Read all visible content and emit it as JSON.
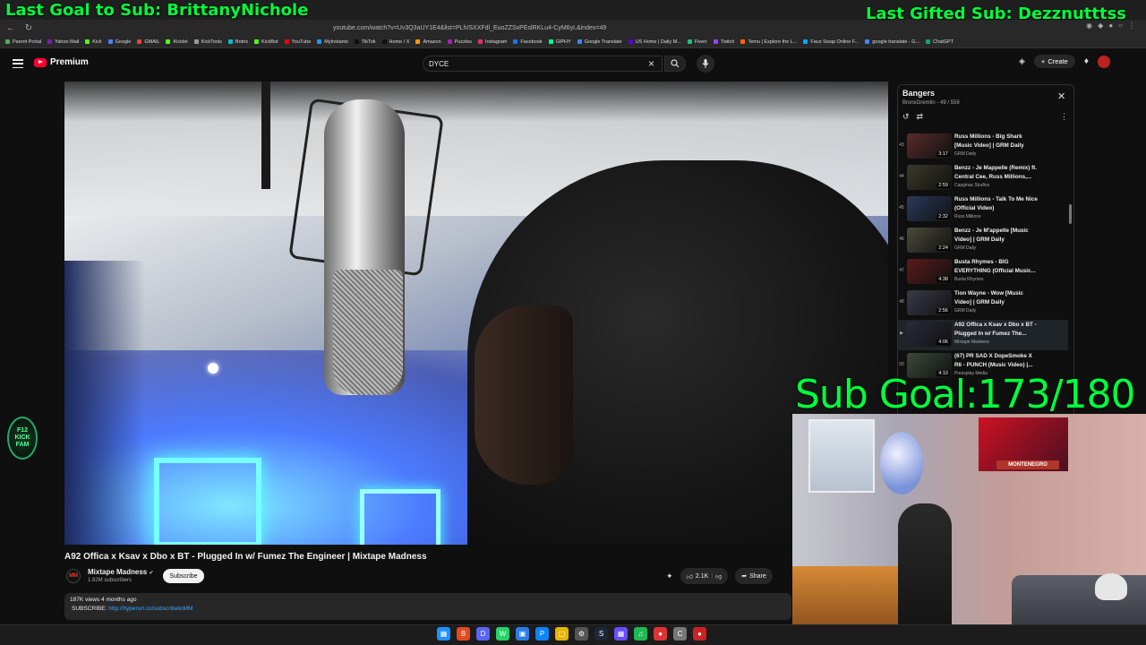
{
  "overlays": {
    "last_goal": "Last Goal to Sub: BrittanyNichole",
    "last_gifted": "Last Gifted Sub: Dezznutttss",
    "sub_goal": "Sub Goal:173/180"
  },
  "browser": {
    "url": "youtube.com/watch?v=Uv3Q3aUY1E4&list=PLhISXXFdl_EuoZZSxPEslRKLu4-CyM6yL&index=49",
    "bookmarks": [
      "Parent Portal",
      "Yahoo Mail",
      "Kick",
      "Google",
      "GMAIL",
      "Kicklet",
      "KickTools",
      "Botrix",
      "KickBot",
      "YouTube",
      "MyInstants",
      "TikTok",
      "Home / X",
      "Amazon",
      "Puzzles",
      "Instagram",
      "Facebook",
      "GIPHY",
      "Google Translate",
      "US Home | Daily M...",
      "Fiverr",
      "Twitch",
      "Temu | Explore the L...",
      "Face Swap Online F...",
      "google translate - G...",
      "ChatGPT"
    ]
  },
  "youtube": {
    "logo_text": "Premium",
    "search_value": "DYCE",
    "create_label": "Create"
  },
  "video": {
    "title": "A92 Offica x Ksav x Dbo x BT - Plugged In w/ Fumez The Engineer | Mixtape Madness",
    "channel": "Mixtape Madness",
    "subscribers": "1.82M subscribers",
    "subscribe_label": "Subscribe",
    "likes": "2.1K",
    "share_label": "Share",
    "meta": "187K views  4 months ago",
    "subscribe_prefix": "SUBSCRIBE:",
    "subscribe_link": "http://hyperurl.co/subscribetoMM"
  },
  "playlist": {
    "title": "Bangers",
    "subtitle": "BronxGremlin - 49 / 559",
    "items": [
      {
        "index": "43",
        "title": "Russ Millions - Big Shark [Music Video] | GRM Daily",
        "channel": "GRM Daily",
        "duration": "3:17"
      },
      {
        "index": "44",
        "title": "Benzz - Je Mappelle (Remix) ft. Central Cee, Russ Millions,...",
        "channel": "Capginac Studios",
        "duration": "2:59"
      },
      {
        "index": "45",
        "title": "Russ Millions - Talk To Me Nice (Official Video)",
        "channel": "Russ Millions",
        "duration": "2:32"
      },
      {
        "index": "46",
        "title": "Benzz - Je M'appelle [Music Video] | GRM Daily",
        "channel": "GRM Daily",
        "duration": "2:24"
      },
      {
        "index": "47",
        "title": "Busta Rhymes - BIG EVERYTHING (Official Music...",
        "channel": "Busta Rhymes",
        "duration": "4:38"
      },
      {
        "index": "48",
        "title": "Tion Wayne - Wow [Music Video] | GRM Daily",
        "channel": "GRM Daily",
        "duration": "2:56"
      },
      {
        "index": "▶",
        "title": "A92 Offica x Ksav x Dbo x BT - Plugged In w/ Fumez The...",
        "channel": "Mixtape Madness",
        "duration": "4:06"
      },
      {
        "index": "50",
        "title": "(67) PR SAD X DopeSmoke X R6 - PUNCH (Music Video) |...",
        "channel": "Pressplay Media",
        "duration": "4:10"
      }
    ]
  },
  "webcam": {
    "banner": "MONTENEGRO"
  },
  "emblem": {
    "text": "F12 KICK FAM"
  },
  "colors": {
    "overlay_green": "#00ff3c",
    "yt_red": "#ff0033",
    "link_blue": "#3ea6ff"
  }
}
